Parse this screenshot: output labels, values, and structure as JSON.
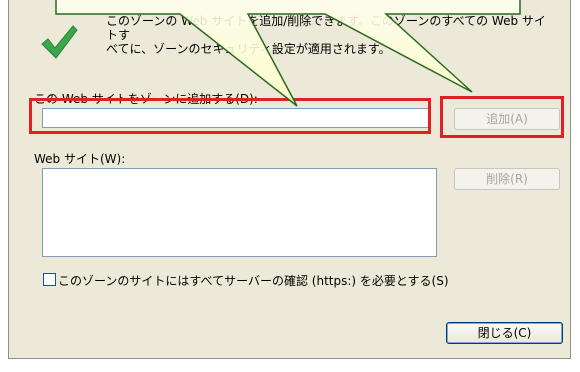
{
  "dialog": {
    "description_line1": "このゾーンの Web サイトを追加/削除できます。このゾーンのすべての Web サイトす",
    "description_line2": "べてに、ゾーンのセキュリティ設定が適用されます。",
    "add_site_label": "この Web サイトをゾーンに追加する(D):",
    "add_site_value": "",
    "add_button": "追加(A)",
    "websites_label": "Web サイト(W):",
    "remove_button": "削除(R)",
    "https_checkbox_label": "このゾーンのサイトにはすべてサーバーの確認 (https:) を必要とする(S)",
    "close_button": "閉じる(C)"
  },
  "colors": {
    "highlight": "#e31f26",
    "callout_fill": "#ffffc8",
    "callout_stroke": "#2a6a1f",
    "check_icon": "#3aa84a"
  }
}
